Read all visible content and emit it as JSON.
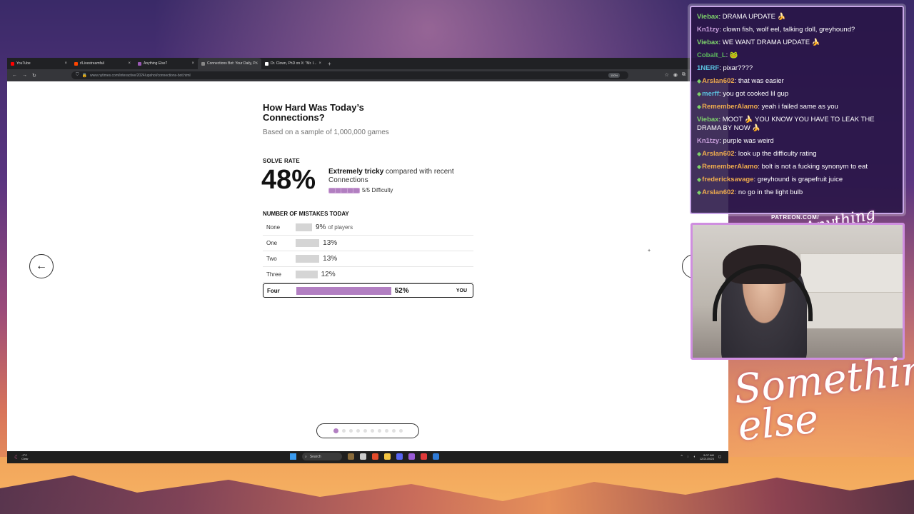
{
  "browser": {
    "tabs": [
      {
        "label": "YouTube",
        "color": "#ff0000",
        "active": false
      },
      {
        "label": "r/Livestreamfail",
        "color": "#ff4500",
        "active": false
      },
      {
        "label": "Anything Else?",
        "color": "#9b59b6",
        "active": false
      },
      {
        "label": "Connections Bot: Your Daily, P...",
        "color": "#888888",
        "active": true
      },
      {
        "label": "Dr. Clown, PhD on X: \"Mr. I...",
        "color": "#ffffff",
        "active": false
      }
    ],
    "url": "www.nytimes.com/interactive/2024/upshot/connections-bot.html",
    "zoom": "150%"
  },
  "page": {
    "title": "How Hard Was Today’s Connections?",
    "subtitle": "Based on a sample of 1,000,000 games",
    "solve_rate_label": "SOLVE RATE",
    "solve_rate_value": "48%",
    "difficulty_strong": "Extremely tricky",
    "difficulty_rest": " compared with recent Connections",
    "difficulty_label": "5/5 Difficulty",
    "difficulty_level": 5,
    "mistakes_label": "NUMBER OF MISTAKES TODAY",
    "mistakes": [
      {
        "label": "None",
        "value": "9%",
        "suffix": "of players",
        "pct": 9,
        "you": false
      },
      {
        "label": "One",
        "value": "13%",
        "suffix": "",
        "pct": 13,
        "you": false
      },
      {
        "label": "Two",
        "value": "13%",
        "suffix": "",
        "pct": 13,
        "you": false
      },
      {
        "label": "Three",
        "value": "12%",
        "suffix": "",
        "pct": 12,
        "you": false
      },
      {
        "label": "Four",
        "value": "52%",
        "suffix": "",
        "pct": 52,
        "you": true,
        "tag": "YOU"
      }
    ],
    "accent_color": "#b27fc2",
    "pager": {
      "count": 10,
      "current": 1
    }
  },
  "taskbar": {
    "weather_temp": "-2°C",
    "weather_desc": "Clear",
    "search_label": "Search",
    "time": "9:07 AM",
    "date": "12/21/2023"
  },
  "chat": [
    {
      "user": "Viebax",
      "color": "#7ed36b",
      "badge": false,
      "text": "DRAMA UPDATE 🍌"
    },
    {
      "user": "Kn1tzy",
      "color": "#c9a0dc",
      "badge": false,
      "text": "clown fish, wolf eel, talking doll, greyhound?"
    },
    {
      "user": "Viebax",
      "color": "#7ed36b",
      "badge": false,
      "text": "WE WANT DRAMA UPDATE 🍌"
    },
    {
      "user": "Cobalt_L",
      "color": "#5cb85c",
      "badge": false,
      "text": "🐸"
    },
    {
      "user": "1NERF",
      "color": "#5bc0de",
      "badge": false,
      "text": "pixar????"
    },
    {
      "user": "Arslan602",
      "color": "#f0ad4e",
      "badge": true,
      "text": "that was easier"
    },
    {
      "user": "merff",
      "color": "#5bc0de",
      "badge": true,
      "text": "you got cooked lil gup"
    },
    {
      "user": "RememberAlamo",
      "color": "#f0ad4e",
      "badge": true,
      "text": "yeah i failed same as you"
    },
    {
      "user": "Viebax",
      "color": "#7ed36b",
      "badge": false,
      "text": "MOOT 🍌 YOU KNOW YOU HAVE TO LEAK THE DRAMA BY NOW 🍌"
    },
    {
      "user": "Kn1tzy",
      "color": "#c9a0dc",
      "badge": false,
      "text": "purple was weird"
    },
    {
      "user": "Arslan602",
      "color": "#f0ad4e",
      "badge": true,
      "text": "look up the difficulty rating"
    },
    {
      "user": "RememberAlamo",
      "color": "#f0ad4e",
      "badge": true,
      "text": "bolt is not a fucking synonym to eat"
    },
    {
      "user": "fredericksavage",
      "color": "#f0ad4e",
      "badge": true,
      "text": "greyhound is grapefruit juice"
    },
    {
      "user": "Arslan602",
      "color": "#f0ad4e",
      "badge": true,
      "text": "no go in the light bulb"
    }
  ],
  "overlay": {
    "patreon": "PATREON.COM/",
    "brand_small": "Anything else?",
    "brand_big": "Something else"
  }
}
